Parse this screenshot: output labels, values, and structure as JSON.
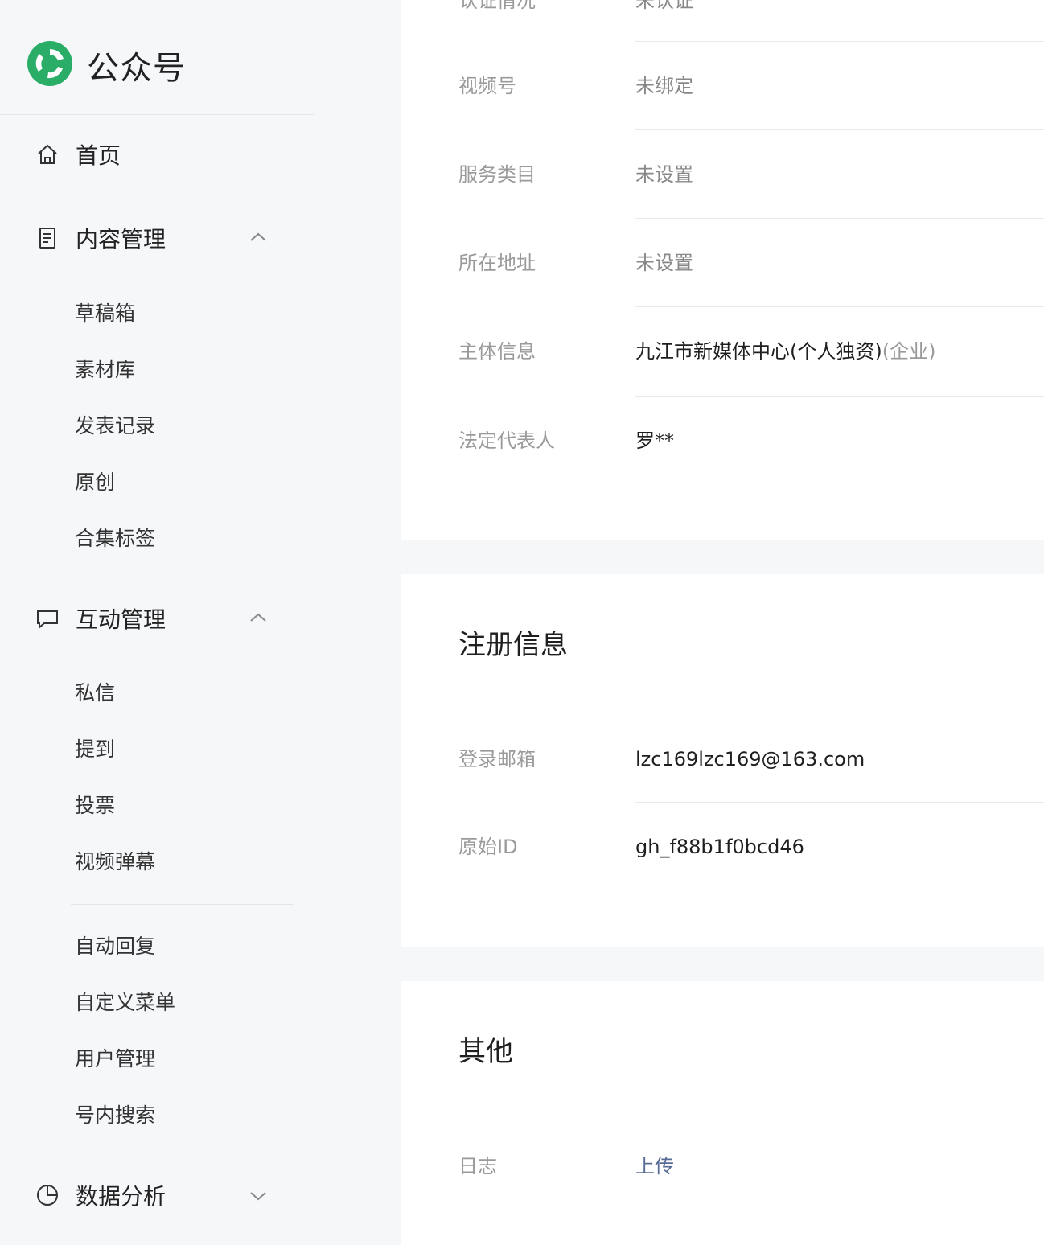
{
  "brand": {
    "name": "公众号",
    "icon": "wechat-official-logo-icon"
  },
  "sidebar": {
    "home": {
      "label": "首页",
      "icon": "home-icon"
    },
    "content": {
      "label": "内容管理",
      "icon": "document-icon",
      "expanded": true,
      "items": [
        "草稿箱",
        "素材库",
        "发表记录",
        "原创",
        "合集标签"
      ]
    },
    "interaction": {
      "label": "互动管理",
      "icon": "message-icon",
      "expanded": true,
      "items": [
        "私信",
        "提到",
        "投票",
        "视频弹幕"
      ],
      "items2": [
        "自动回复",
        "自定义菜单",
        "用户管理",
        "号内搜索"
      ]
    },
    "analytics": {
      "label": "数据分析",
      "icon": "pie-chart-icon",
      "expanded": false
    }
  },
  "account_info": {
    "rows": [
      {
        "label": "认证情况",
        "value": "未认证"
      },
      {
        "label": "视频号",
        "value": "未绑定"
      },
      {
        "label": "服务类目",
        "value": "未设置"
      },
      {
        "label": "所在地址",
        "value": "未设置"
      },
      {
        "label": "主体信息",
        "value": "九江市新媒体中心(个人独资)",
        "suffix": "(企业)"
      },
      {
        "label": "法定代表人",
        "value": "罗**"
      }
    ]
  },
  "registration": {
    "title": "注册信息",
    "rows": [
      {
        "label": "登录邮箱",
        "value": "lzc169lzc169@163.com"
      },
      {
        "label": "原始ID",
        "value": "gh_f88b1f0bcd46"
      }
    ]
  },
  "other": {
    "title": "其他",
    "rows": [
      {
        "label": "日志",
        "value": "上传"
      }
    ]
  },
  "colors": {
    "accent_green": "#2aae67",
    "link": "#576b95",
    "sidebar_bg": "#f6f7f9"
  }
}
